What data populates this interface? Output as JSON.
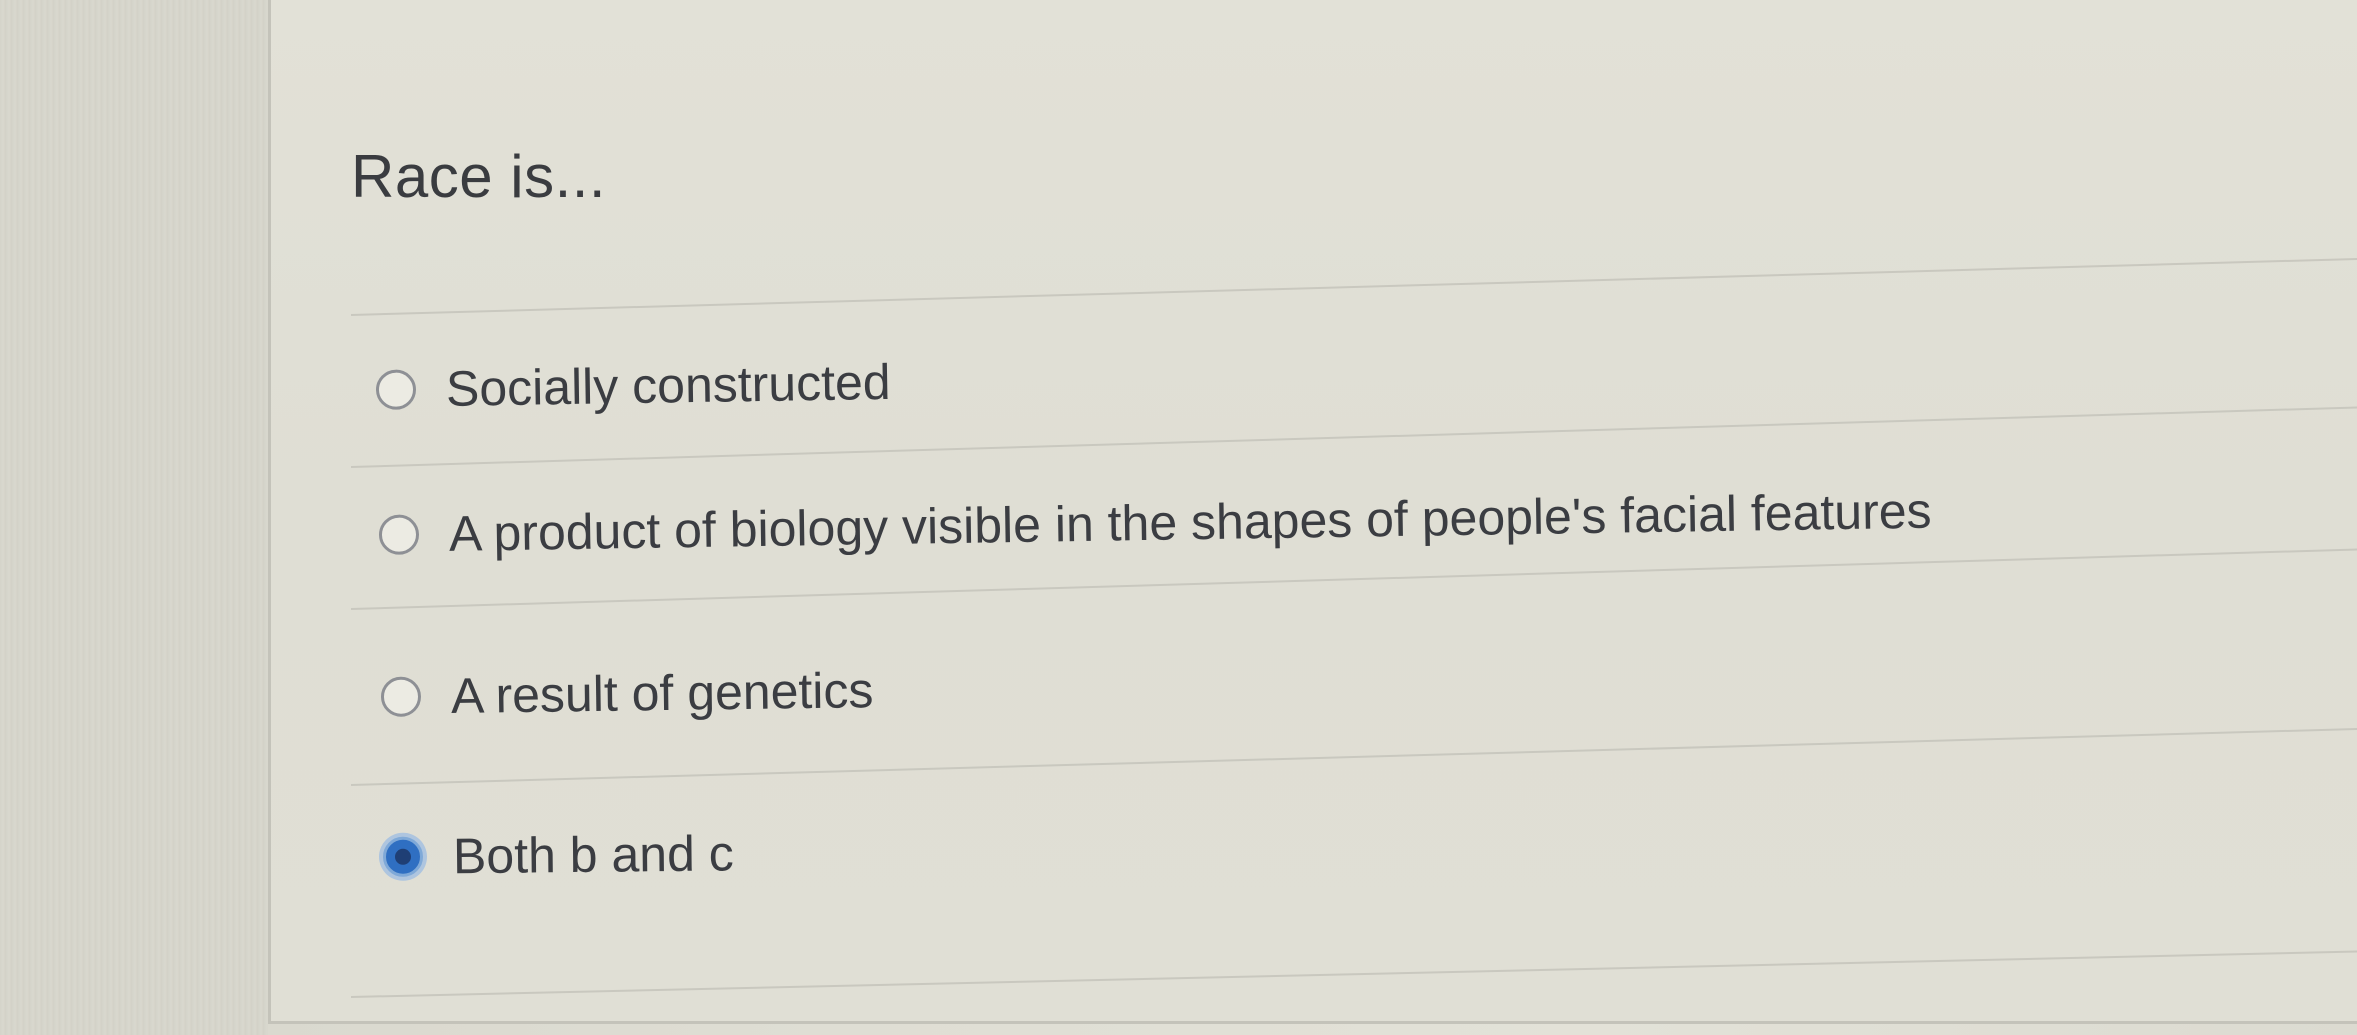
{
  "question": {
    "text": "Race is..."
  },
  "options": [
    {
      "label": "Socially constructed",
      "selected": false
    },
    {
      "label": "A product of biology visible in the shapes of people's facial features",
      "selected": false
    },
    {
      "label": "A result of genetics",
      "selected": false
    },
    {
      "label": "Both b and c",
      "selected": true
    }
  ],
  "colors": {
    "selected_radio": "#2f6fc2",
    "text": "#3b3d42",
    "background": "#dfded4"
  }
}
